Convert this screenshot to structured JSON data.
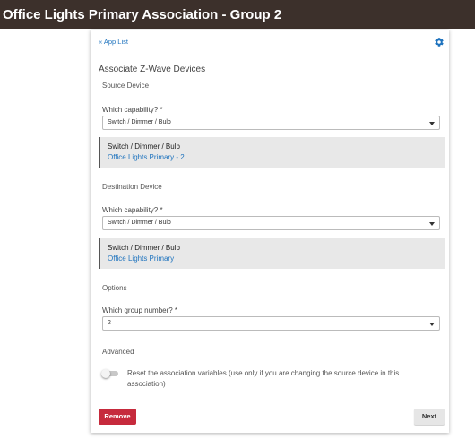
{
  "header": {
    "title": "Office Lights Primary Association - Group 2"
  },
  "nav": {
    "app_list": "« App List"
  },
  "icons": {
    "settings": "gear-icon",
    "dropdown": "chevron-down-icon"
  },
  "colors": {
    "topbar": "#3c302b",
    "link": "#1e73be",
    "remove": "#c62a3c"
  },
  "main": {
    "heading": "Associate Z-Wave Devices"
  },
  "source": {
    "heading": "Source Device",
    "capability_label": "Which capability? *",
    "capability_value": "Switch / Dimmer / Bulb",
    "device_capability": "Switch / Dimmer / Bulb",
    "device_name": "Office Lights Primary - 2"
  },
  "destination": {
    "heading": "Destination Device",
    "capability_label": "Which capability? *",
    "capability_value": "Switch / Dimmer / Bulb",
    "device_capability": "Switch / Dimmer / Bulb",
    "device_name": "Office Lights Primary"
  },
  "options": {
    "heading": "Options",
    "group_label": "Which group number? *",
    "group_value": "2"
  },
  "advanced": {
    "heading": "Advanced",
    "reset_label": "Reset the association variables (use only if you are changing the source device in this association)",
    "reset_enabled": false
  },
  "buttons": {
    "remove": "Remove",
    "next": "Next"
  }
}
